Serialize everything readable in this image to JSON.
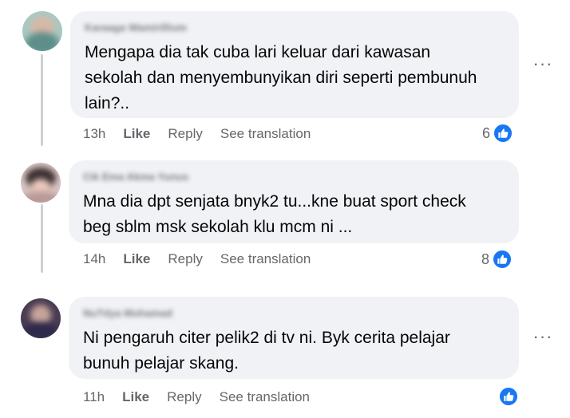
{
  "comments": [
    {
      "author": "Karaaga Wamirillium",
      "text": "Mengapa dia tak cuba lari keluar dari kawasan\nsekolah dan menyembunyikan diri seperti pembunuh\nlain?..",
      "time": "13h",
      "like_label": "Like",
      "reply_label": "Reply",
      "translate_label": "See translation",
      "reaction_count": "6",
      "more_label": "···"
    },
    {
      "author": "Cik Ema Akma Yunus",
      "text": "Mna dia dpt senjata bnyk2 tu...kne buat sport check\nbeg sblm msk sekolah klu mcm ni ...",
      "time": "14h",
      "like_label": "Like",
      "reply_label": "Reply",
      "translate_label": "See translation",
      "reaction_count": "8",
      "more_label": ""
    },
    {
      "author": "NuTdya Mohamad",
      "text": "Ni pengaruh citer pelik2 di tv ni. Byk cerita pelajar\nbunuh pelajar skang.",
      "time": "11h",
      "like_label": "Like",
      "reply_label": "Reply",
      "translate_label": "See translation",
      "reaction_count": "",
      "more_label": "···"
    }
  ],
  "colors": {
    "bubble": "#f0f2f5",
    "secondary_text": "#65676b",
    "like_blue": "#1877f2",
    "thread_line": "#ced0d4"
  },
  "icons": {
    "reaction": "thumbs-up-icon",
    "more": "more-horizontal-icon"
  }
}
